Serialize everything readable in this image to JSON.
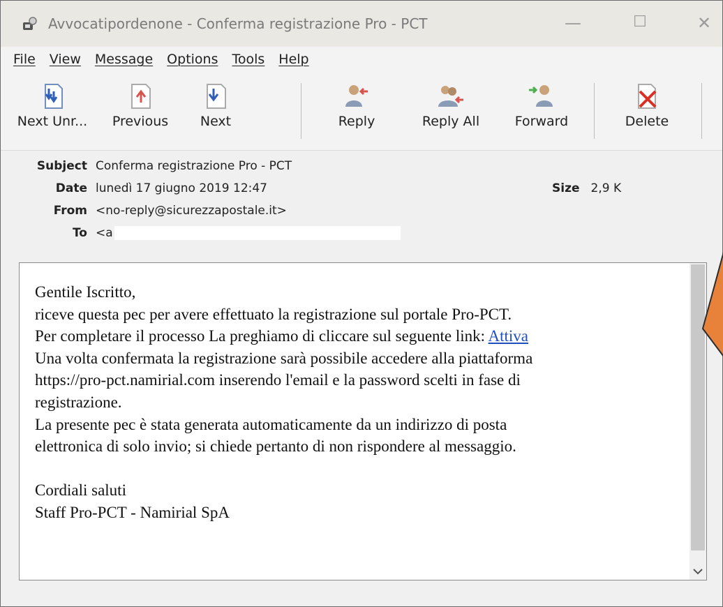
{
  "window": {
    "title": "Avvocatipordenone - Conferma registrazione Pro - PCT",
    "controls": {
      "minimize": "—",
      "maximize": "☐",
      "close": "✕"
    }
  },
  "menu": [
    "File",
    "View",
    "Message",
    "Options",
    "Tools",
    "Help"
  ],
  "toolbar": {
    "next_unread": "Next Unr...",
    "previous": "Previous",
    "next": "Next",
    "reply": "Reply",
    "reply_all": "Reply All",
    "forward": "Forward",
    "delete": "Delete"
  },
  "headers": {
    "subject_label": "Subject",
    "subject": "Conferma registrazione Pro - PCT",
    "date_label": "Date",
    "date": "lunedì 17 giugno 2019 12:47",
    "size_label": "Size",
    "size": "2,9 K",
    "from_label": "From",
    "from": "<no-reply@sicurezzapostale.it>",
    "to_label": "To",
    "to": "<a"
  },
  "body": {
    "line1": "Gentile Iscritto,",
    "line2": "riceve questa pec per avere effettuato la registrazione sul portale Pro-PCT.",
    "line3_pre": "Per completare il processo La preghiamo di cliccare sul seguente link: ",
    "link": "Attiva",
    "line4": "Una volta confermata la registrazione sarà possibile accedere alla piattaforma",
    "line5": "https://pro-pct.namirial.com inserendo l'email e la password scelti in fase di",
    "line6": "registrazione.",
    "line7": "La presente pec è stata generata automaticamente da un indirizzo di posta",
    "line8": "elettronica di solo invio; si chiede pertanto di non rispondere al messaggio.",
    "line9": "",
    "line10": "Cordiali saluti",
    "line11": "Staff Pro-PCT - Namirial SpA"
  },
  "colors": {
    "titlebar": "#e9e8e3",
    "link": "#1f4fbf",
    "annotation_arrow": "#e8823a",
    "delete_red": "#d93025",
    "arrow_blue": "#2f5fb8"
  }
}
